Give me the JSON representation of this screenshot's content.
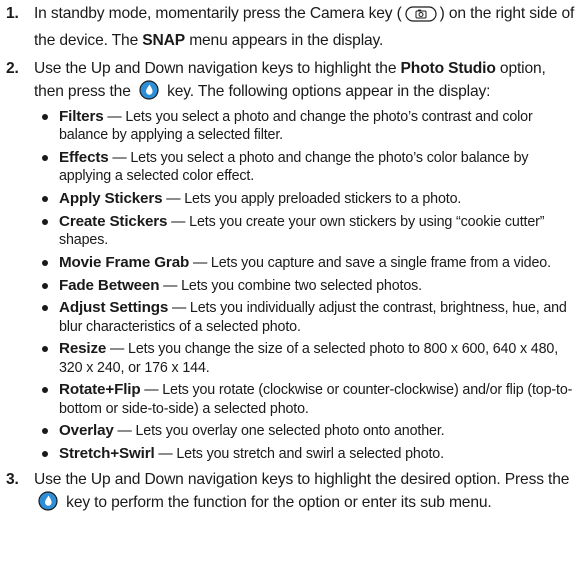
{
  "steps": [
    {
      "num": "1.",
      "text_a": "In standby mode, momentarily press the Camera key (",
      "text_b": ") on the right side of the device. The ",
      "bold": "SNAP",
      "text_c": " menu appears in the display."
    },
    {
      "num": "2.",
      "text_a": "Use the Up and Down navigation keys to highlight the ",
      "bold": "Photo Studio",
      "text_b": " option, then press the ",
      "text_c": " key. The following options appear in the display:"
    },
    {
      "num": "3.",
      "text_a": "Use the Up and Down navigation keys to highlight the desired option. Press the ",
      "text_b": " key to perform the function for the option or enter its sub menu."
    }
  ],
  "options": [
    {
      "term": "Filters",
      "desc": " — Lets you select a photo and change the photo’s contrast and color balance by applying a selected filter."
    },
    {
      "term": "Effects",
      "desc": " — Lets you select a photo and change the photo’s color balance by applying a selected color effect."
    },
    {
      "term": "Apply Stickers",
      "desc": " — Lets you apply preloaded stickers to a photo."
    },
    {
      "term": "Create Stickers",
      "desc": " — Lets you create your own stickers by using “cookie cutter” shapes."
    },
    {
      "term": "Movie Frame Grab",
      "desc": " — Lets you capture and save a single frame from a video."
    },
    {
      "term": "Fade Between",
      "desc": " — Lets you combine two selected photos."
    },
    {
      "term": "Adjust Settings",
      "desc": "  — Lets you individually adjust the contrast, brightness, hue, and blur characteristics of a selected photo."
    },
    {
      "term": "Resize",
      "desc": " — Lets you change the size of a selected photo to 800 x 600, 640 x 480, 320 x 240, or 176 x 144."
    },
    {
      "term": "Rotate+Flip",
      "desc": " — Lets you rotate (clockwise or counter-clockwise) and/or flip (top-to-bottom or side-to-side) a selected photo."
    },
    {
      "term": "Overlay",
      "desc": " — Lets you overlay one selected photo onto another."
    },
    {
      "term": "Stretch+Swirl",
      "desc": " — Lets you stretch and swirl a selected photo."
    }
  ],
  "icons": {
    "camera_key": "camera-key-icon",
    "ok_key": "ok-key-icon",
    "ok_key_color": "#2f8fd6"
  }
}
